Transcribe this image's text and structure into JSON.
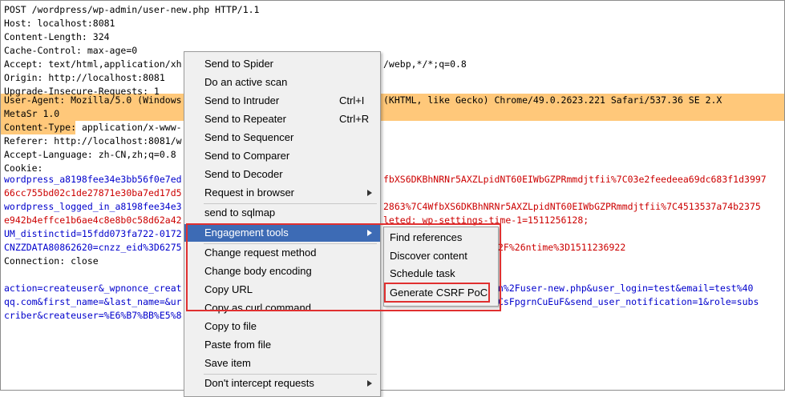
{
  "request_lines": [
    {
      "text": "POST /wordpress/wp-admin/user-new.php HTTP/1.1"
    },
    {
      "text": "Host: localhost:8081"
    },
    {
      "text": "Content-Length: 324"
    },
    {
      "text": "Cache-Control: max-age=0"
    },
    {
      "text": "Accept: text/html,application/xh",
      "tail": "/webp,*/*;q=0.8"
    },
    {
      "text": "Origin: http://localhost:8081"
    },
    {
      "text": "Upgrade-Insecure-Requests: 1"
    },
    {
      "text": "User-Agent: Mozilla/5.0 (Windows",
      "tail": "(KHTML, like Gecko) Chrome/49.0.2623.221 Safari/537.36 SE 2.X"
    },
    {
      "text": "MetaSr 1.0"
    },
    {
      "text_key": "Content-Type:",
      "text": " application/x-www-"
    },
    {
      "text": "Referer: http://localhost:8081/w"
    },
    {
      "text": "Accept-Language: zh-CN,zh;q=0.8"
    },
    {
      "text": "Cookie:"
    },
    {
      "text": "wordpress_a8198fee34e3bb56f0e7ed",
      "tail": "fbXS6DKBhNRNr5AXZLpidNT60EIWbGZPRmmdjtfii%7C03e2feedeea69dc683f1d3997"
    },
    {
      "text": "66cc755bd02c1de27871e30ba7ed17d5"
    },
    {
      "text": "wordpress_logged_in_a8198fee34e3",
      "tail": "2863%7C4WfbXS6DKBhNRNr5AXZLpidNT60EIWbGZPRmmdjtfii%7C4513537a74b2375"
    },
    {
      "text": "e942b4effce1b6ae4c8e8b0c58d62a42",
      "tail": "leted; wp-settings-time-1=1511256128;"
    },
    {
      "text": "UM_distinctid=15fdd073fa722-0172"
    },
    {
      "text": "CNZZDATA80862620=cnzz_eid%3D6275",
      "tail": "2F%26ntime%3D1511236922"
    },
    {
      "text": "Connection: close"
    },
    {
      "text": ""
    },
    {
      "text": "action=createuser&_wpnonce_creat",
      "tail": "n%2Fuser-new.php&user_login=test&email=test%40"
    },
    {
      "text": "qq.com&first_name=&last_name=&ur",
      "tail": "CsFpgrnCuEuF&send_user_notification=1&role=subs"
    },
    {
      "text": "criber&createuser=%E6%B7%BB%E5%8",
      "tail": ""
    }
  ],
  "context_menu": {
    "items": [
      {
        "label": "Send to Spider",
        "shortcut": "",
        "submenu": false
      },
      {
        "label": "Do an active scan",
        "shortcut": "",
        "submenu": false
      },
      {
        "label": "Send to Intruder",
        "shortcut": "Ctrl+I",
        "submenu": false
      },
      {
        "label": "Send to Repeater",
        "shortcut": "Ctrl+R",
        "submenu": false
      },
      {
        "label": "Send to Sequencer",
        "shortcut": "",
        "submenu": false
      },
      {
        "label": "Send to Comparer",
        "shortcut": "",
        "submenu": false
      },
      {
        "label": "Send to Decoder",
        "shortcut": "",
        "submenu": false
      },
      {
        "label": "Request in browser",
        "shortcut": "",
        "submenu": true
      },
      {
        "label": "send to sqlmap",
        "shortcut": "",
        "submenu": false
      },
      {
        "label": "Engagement tools",
        "shortcut": "",
        "submenu": true,
        "active": true
      },
      {
        "label": "Change request method",
        "shortcut": "",
        "submenu": false
      },
      {
        "label": "Change body encoding",
        "shortcut": "",
        "submenu": false
      },
      {
        "label": "Copy URL",
        "shortcut": "",
        "submenu": false
      },
      {
        "label": "Copy as curl command",
        "shortcut": "",
        "submenu": false
      },
      {
        "label": "Copy to file",
        "shortcut": "",
        "submenu": false
      },
      {
        "label": "Paste from file",
        "shortcut": "",
        "submenu": false
      },
      {
        "label": "Save item",
        "shortcut": "",
        "submenu": false
      },
      {
        "label": "Don't intercept requests",
        "shortcut": "",
        "submenu": true
      }
    ]
  },
  "engagement_submenu": {
    "items": [
      {
        "label": "Find references"
      },
      {
        "label": "Discover content"
      },
      {
        "label": "Schedule task"
      },
      {
        "label": "Generate CSRF PoC"
      }
    ]
  },
  "colors": {
    "highlight": "#ffc87a",
    "param_name": "#0000cc",
    "param_value": "#cc0000",
    "menu_active": "#3d6bb5",
    "annotation": "#e03030"
  }
}
